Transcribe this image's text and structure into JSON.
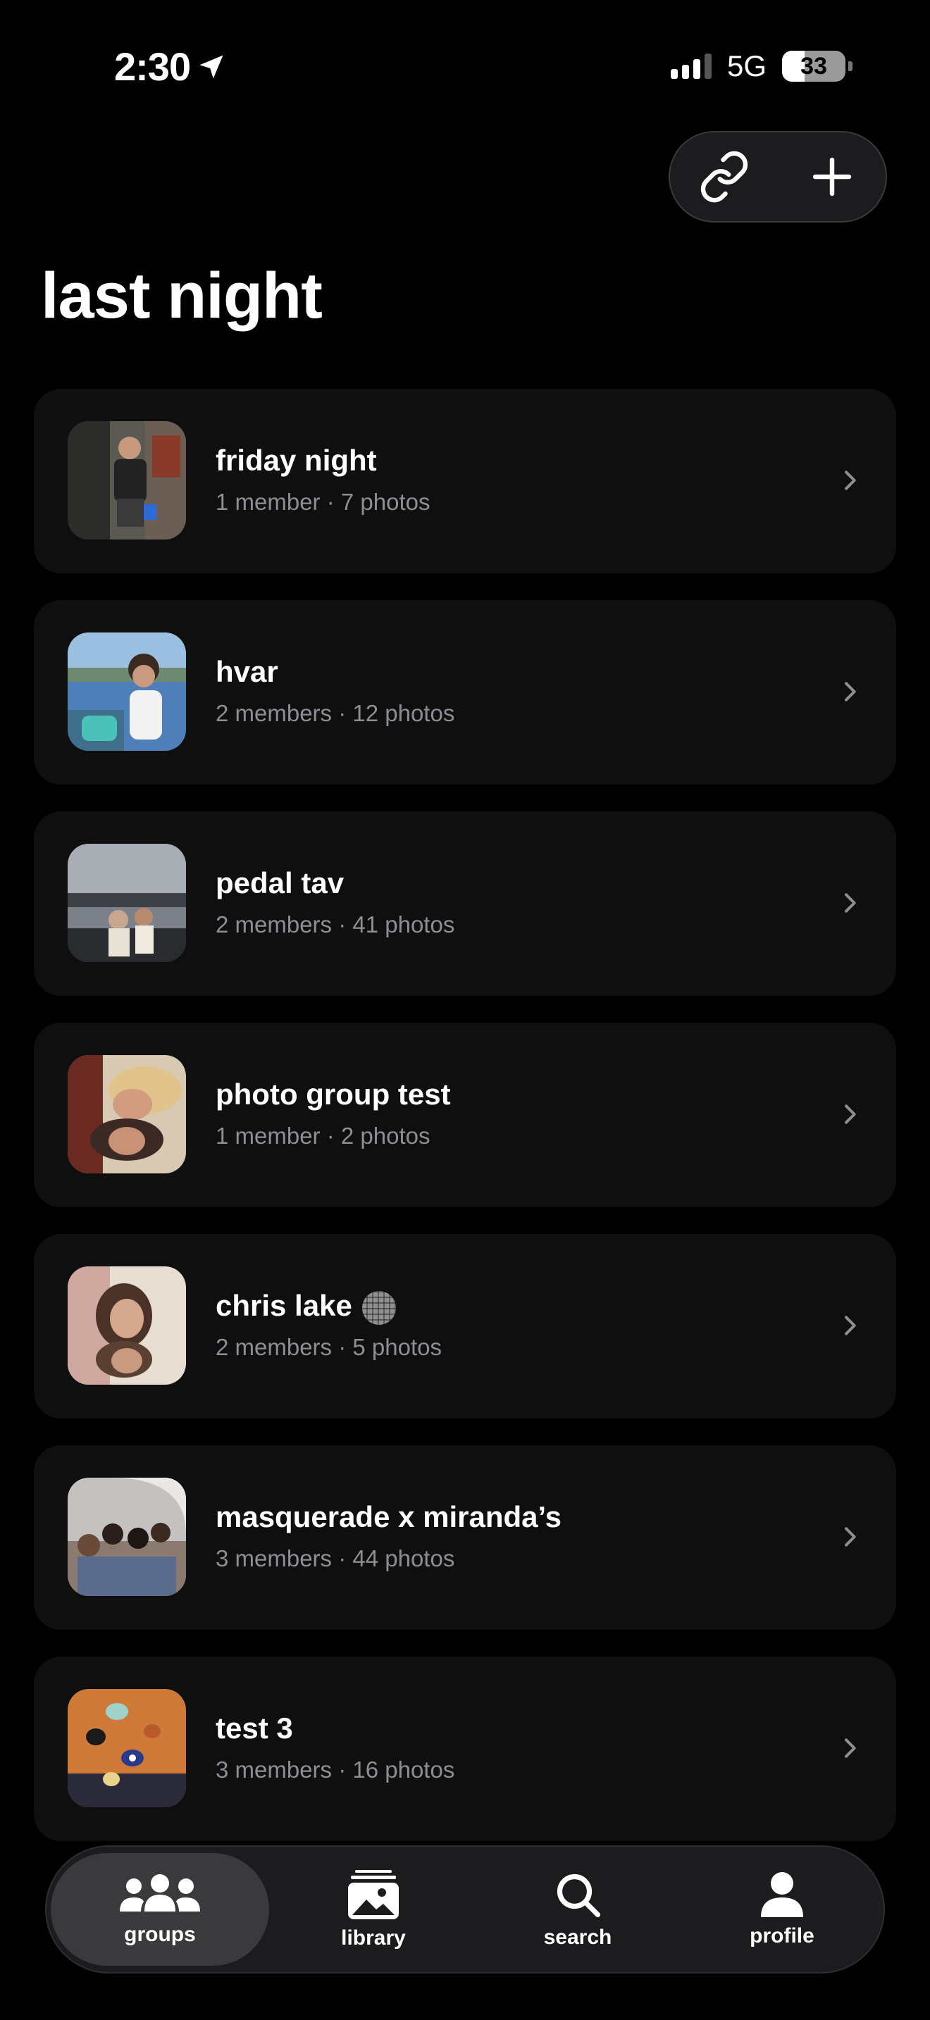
{
  "status": {
    "time": "2:30",
    "network": "5G",
    "battery": "33"
  },
  "page": {
    "title": "last night"
  },
  "groups": [
    {
      "name": "friday night",
      "meta": "1 member · 7 photos"
    },
    {
      "name": "hvar",
      "meta": "2 members · 12 photos"
    },
    {
      "name": "pedal tav",
      "meta": "2 members · 41 photos"
    },
    {
      "name": "photo group test",
      "meta": "1 member · 2 photos"
    },
    {
      "name": "chris lake",
      "meta": "2 members · 5 photos"
    },
    {
      "name": "masquerade x miranda’s",
      "meta": "3 members · 44 photos"
    },
    {
      "name": "test 3",
      "meta": "3 members · 16 photos"
    }
  ],
  "tabs": [
    {
      "label": "groups",
      "icon": "people-icon",
      "active": true
    },
    {
      "label": "library",
      "icon": "photo-library-icon",
      "active": false
    },
    {
      "label": "search",
      "icon": "magnifier-icon",
      "active": false
    },
    {
      "label": "profile",
      "icon": "person-icon",
      "active": false
    }
  ],
  "colors": {
    "background": "#000000",
    "card": "#0f0f10",
    "secondary_text": "#8e8e93",
    "pill": "#1c1c1e"
  }
}
